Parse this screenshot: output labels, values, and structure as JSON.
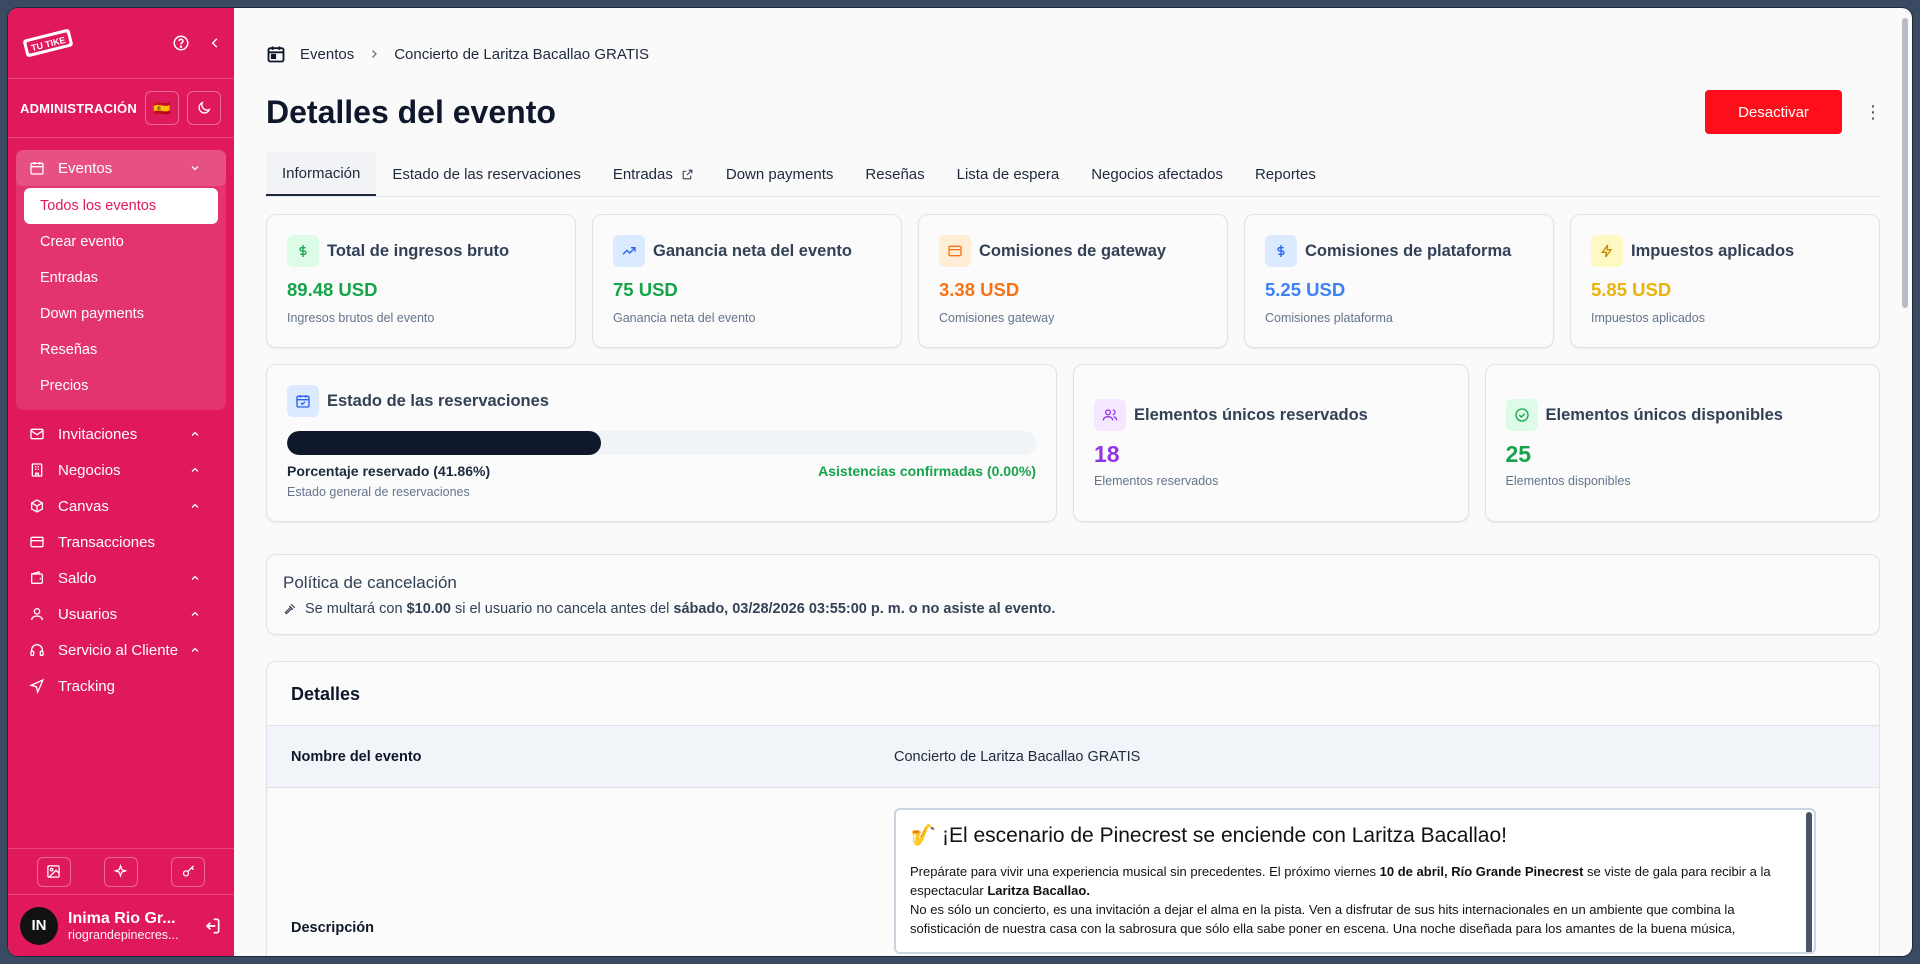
{
  "sidebar": {
    "logo_text": "TU TIKE",
    "admin_label": "ADMINISTRACIÓN",
    "flag": "🇪🇸",
    "nav": [
      {
        "label": "Eventos"
      },
      {
        "label": "Invitaciones"
      },
      {
        "label": "Negocios"
      },
      {
        "label": "Canvas"
      },
      {
        "label": "Transacciones"
      },
      {
        "label": "Saldo"
      },
      {
        "label": "Usuarios"
      },
      {
        "label": "Servicio al Cliente"
      },
      {
        "label": "Tracking"
      }
    ],
    "sub_items": [
      "Todos los eventos",
      "Crear evento",
      "Entradas",
      "Down payments",
      "Reseñas",
      "Precios"
    ],
    "user": {
      "initials": "IN",
      "name": "Inima Rio Gr...",
      "email": "riograndepinecres..."
    }
  },
  "breadcrumb": {
    "root": "Eventos",
    "current": "Concierto de Laritza Bacallao GRATIS"
  },
  "page_title": "Detalles del evento",
  "deactivate_label": "Desactivar",
  "tabs": [
    "Información",
    "Estado de las reservaciones",
    "Entradas",
    "Down payments",
    "Reseñas",
    "Lista de espera",
    "Negocios afectados",
    "Reportes"
  ],
  "stats": [
    {
      "title": "Total de ingresos bruto",
      "value": "89.48 USD",
      "sub": "Ingresos brutos del evento",
      "color": "#16a34a",
      "icon": "dollar-icon"
    },
    {
      "title": "Ganancia neta del evento",
      "value": "75 USD",
      "sub": "Ganancia neta del evento",
      "color": "#16a34a",
      "icon": "trending-up-icon"
    },
    {
      "title": "Comisiones de gateway",
      "value": "3.38 USD",
      "sub": "Comisiones gateway",
      "color": "#f97316",
      "icon": "credit-card-icon"
    },
    {
      "title": "Comisiones de plataforma",
      "value": "5.25 USD",
      "sub": "Comisiones plataforma",
      "color": "#3b82f6",
      "icon": "dollar-icon"
    },
    {
      "title": "Impuestos aplicados",
      "value": "5.85 USD",
      "sub": "Impuestos aplicados",
      "color": "#eab308",
      "icon": "zap-icon"
    }
  ],
  "reservations": {
    "title": "Estado de las reservaciones",
    "progress": 0.4186,
    "left": "Porcentaje reservado (41.86%)",
    "right": "Asistencias confirmadas (0.00%)",
    "sub": "Estado general de reservaciones"
  },
  "reserved": {
    "title": "Elementos únicos reservados",
    "value": "18",
    "sub": "Elementos reservados",
    "color": "#9333ea"
  },
  "available": {
    "title": "Elementos únicos disponibles",
    "value": "25",
    "sub": "Elementos disponibles",
    "color": "#16a34a"
  },
  "policy": {
    "title": "Política de cancelación",
    "t1": "Se multará con ",
    "amount": "$10.00",
    "t2": " si el usuario no cancela antes del ",
    "date": "sábado, 03/28/2026 03:55:00 p. m. o no asiste al evento."
  },
  "details": {
    "title": "Detalles",
    "name_label": "Nombre del evento",
    "name_value": "Concierto de Laritza Bacallao GRATIS",
    "desc_label": "Descripción",
    "desc_heading": "🎷 ¡El escenario de Pinecrest se enciende con Laritza Bacallao!",
    "p1a": "Prepárate para vivir una experiencia musical sin precedentes. El próximo viernes ",
    "p1b": "10 de abril, Río Grande Pinecrest",
    "p1c": " se viste de gala para recibir a la espectacular ",
    "p1d": "Laritza Bacallao.",
    "p2": "No es sólo un concierto, es una invitación a dejar el alma en la pista. Ven a disfrutar de sus hits internacionales en un ambiente que combina la sofisticación de nuestra casa con la sabrosura que sólo ella sabe poner en escena. Una noche diseñada para los amantes de la buena música,"
  }
}
